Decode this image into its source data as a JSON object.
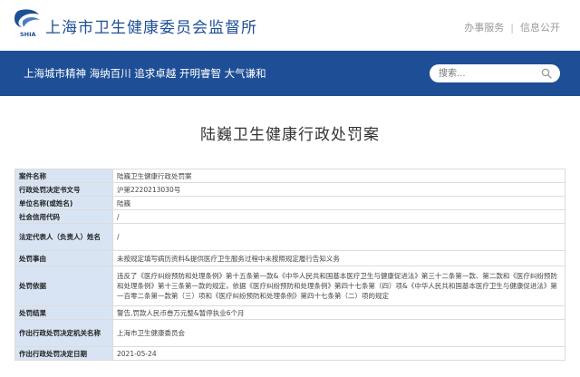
{
  "header": {
    "site_title": "上海市卫生健康委员会监督所",
    "logo_text": "SHIA",
    "links": [
      "办事服务",
      "信息公开"
    ]
  },
  "banner": {
    "slogan": "上海城市精神 海纳百川 追求卓越 开明睿智 大气谦和",
    "search_placeholder": "搜索..."
  },
  "page": {
    "title": "陆巍卫生健康行政处罚案"
  },
  "table": {
    "rows": [
      {
        "label": "案件名称",
        "value": "陆巍卫生健康行政处罚案"
      },
      {
        "label": "行政处罚决定书文号",
        "value": "沪第2220213030号"
      },
      {
        "label": "单位名称(或姓名)",
        "value": "陆巍"
      },
      {
        "label": "社会信用代码",
        "value": "/"
      },
      {
        "label": "法定代表人（负责人）姓名",
        "value": "/"
      },
      {
        "label": "处罚事由",
        "value": "未按规定填写病历资料&提供医疗卫生服务过程中未按照规定履行告知义务"
      },
      {
        "label": "处罚依据",
        "value": "违反了《医疗纠纷预防和处理条例》第十五条第一款&《中华人民共和国基本医疗卫生与健康促进法》第三十二条第一款、第二款和《医疗纠纷预防和处理条例》第十三条第一款的规定，依据《医疗纠纷预防和处理条例》第四十七条第（四）项&《中华人民共和国基本医疗卫生与健康促进法》第一百零二条第一款第（三）项和《医疗纠纷预防和处理条例》第四十七条第（二）项的规定"
      },
      {
        "label": "处罚结果",
        "value": "警告,罚款人民币叁万元整&暂停执业6个月"
      },
      {
        "label": "作出行政处罚决定机关名称",
        "value": "上海市卫生健康委员会"
      },
      {
        "label": "作出行政处罚决定日期",
        "value": "2021-05-24"
      }
    ]
  },
  "colors": {
    "brand_blue": "#1e4f96",
    "label_bg": "#d8e4f3"
  }
}
